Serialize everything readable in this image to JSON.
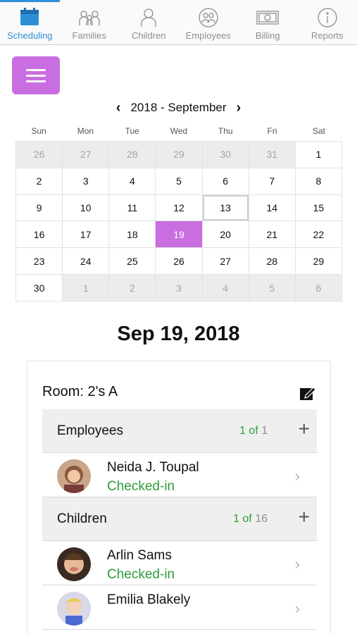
{
  "tabs": [
    {
      "label": "Scheduling",
      "icon": "calendar-icon",
      "active": true
    },
    {
      "label": "Families",
      "icon": "families-icon",
      "active": false
    },
    {
      "label": "Children",
      "icon": "child-icon",
      "active": false
    },
    {
      "label": "Employees",
      "icon": "employees-icon",
      "active": false
    },
    {
      "label": "Billing",
      "icon": "money-icon",
      "active": false
    },
    {
      "label": "Reports",
      "icon": "info-icon",
      "active": false
    }
  ],
  "calendar": {
    "prev_arrow": "‹",
    "next_arrow": "›",
    "month_title": "2018 - September",
    "weekdays": [
      "Sun",
      "Mon",
      "Tue",
      "Wed",
      "Thu",
      "Fri",
      "Sat"
    ],
    "days": [
      {
        "d": "26",
        "other": true
      },
      {
        "d": "27",
        "other": true
      },
      {
        "d": "28",
        "other": true
      },
      {
        "d": "29",
        "other": true
      },
      {
        "d": "30",
        "other": true
      },
      {
        "d": "31",
        "other": true
      },
      {
        "d": "1"
      },
      {
        "d": "2"
      },
      {
        "d": "3"
      },
      {
        "d": "4"
      },
      {
        "d": "5"
      },
      {
        "d": "6"
      },
      {
        "d": "7"
      },
      {
        "d": "8"
      },
      {
        "d": "9"
      },
      {
        "d": "10"
      },
      {
        "d": "11"
      },
      {
        "d": "12"
      },
      {
        "d": "13",
        "today": true
      },
      {
        "d": "14"
      },
      {
        "d": "15"
      },
      {
        "d": "16"
      },
      {
        "d": "17"
      },
      {
        "d": "18"
      },
      {
        "d": "19",
        "selected": true
      },
      {
        "d": "20"
      },
      {
        "d": "21"
      },
      {
        "d": "22"
      },
      {
        "d": "23"
      },
      {
        "d": "24"
      },
      {
        "d": "25"
      },
      {
        "d": "26"
      },
      {
        "d": "27"
      },
      {
        "d": "28"
      },
      {
        "d": "29"
      },
      {
        "d": "30"
      },
      {
        "d": "1",
        "other": true
      },
      {
        "d": "2",
        "other": true
      },
      {
        "d": "3",
        "other": true
      },
      {
        "d": "4",
        "other": true
      },
      {
        "d": "5",
        "other": true
      },
      {
        "d": "6",
        "other": true
      }
    ]
  },
  "selected_date": "Sep 19, 2018",
  "room": {
    "title": "Room: 2's A",
    "employees": {
      "title": "Employees",
      "count": "1 of",
      "total": "1",
      "people": [
        {
          "name": "Neida J. Toupal",
          "status": "Checked-in"
        }
      ]
    },
    "children": {
      "title": "Children",
      "count": "1 of",
      "total": "16",
      "people": [
        {
          "name": "Arlin Sams",
          "status": "Checked-in"
        },
        {
          "name": "Emilia Blakely",
          "status": ""
        }
      ]
    }
  },
  "colors": {
    "accent_purple": "#c96ee0",
    "active_tab_blue": "#2f8fd6",
    "status_green": "#2e9e3a"
  }
}
